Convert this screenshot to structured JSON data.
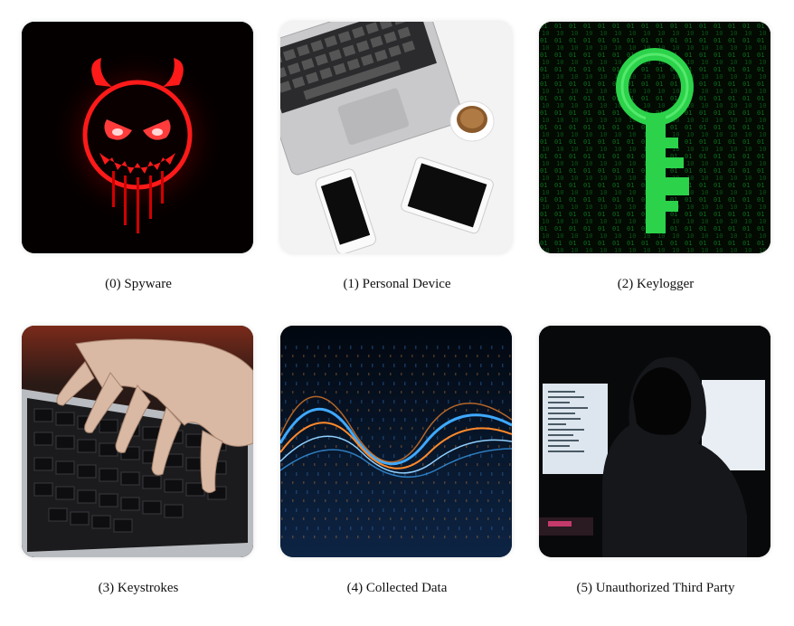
{
  "items": [
    {
      "caption": "(0) Spyware",
      "icon": "devil-face-icon"
    },
    {
      "caption": "(1) Personal Device",
      "icon": "laptop-phone-tablet-icon"
    },
    {
      "caption": "(2) Keylogger",
      "icon": "binary-key-icon"
    },
    {
      "caption": "(3) Keystrokes",
      "icon": "hands-typing-icon"
    },
    {
      "caption": "(4) Collected Data",
      "icon": "data-wave-icon"
    },
    {
      "caption": "(5) Unauthorized Third Party",
      "icon": "hooded-hacker-icon"
    }
  ],
  "colors": {
    "spyware_red": "#ff1a1a",
    "keylogger_green": "#2bd24a",
    "data_blue": "#3fa9ff",
    "data_orange": "#ff8a2b"
  }
}
